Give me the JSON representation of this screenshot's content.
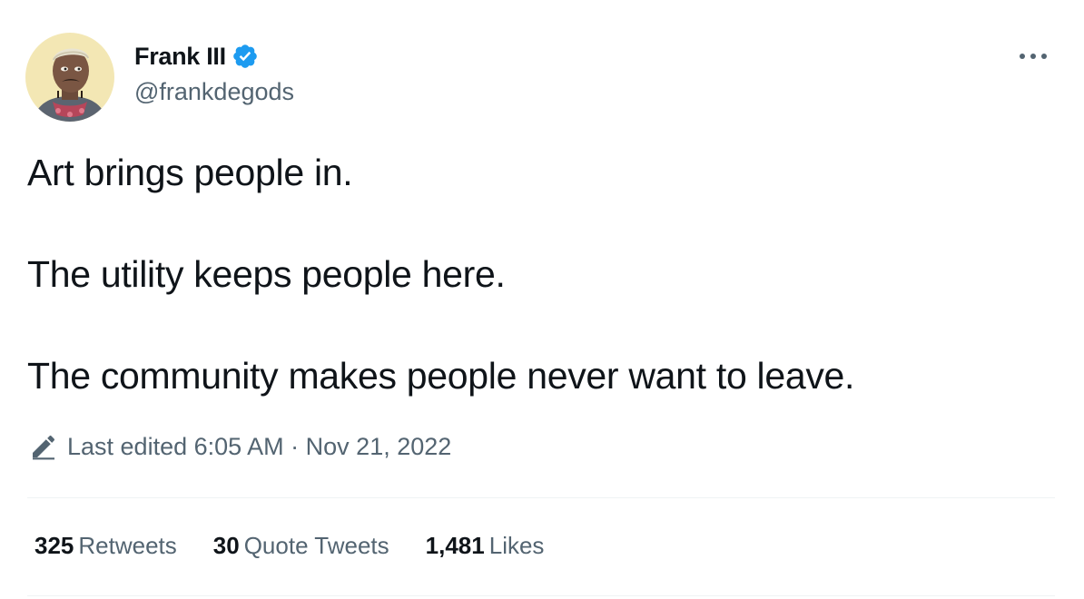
{
  "author": {
    "display_name": "Frank III",
    "handle": "@frankdegods",
    "verified": true,
    "verified_color": "#1d9bf0"
  },
  "more_icon": "more-horizontal-icon",
  "tweet": {
    "lines": [
      "Art brings people in.",
      "The utility keeps people here.",
      "The community makes people never want to leave."
    ]
  },
  "edited": {
    "icon": "pencil-icon",
    "text": "Last edited 6:05 AM · Nov 21, 2022"
  },
  "stats": {
    "retweets": {
      "count": "325",
      "label": "Retweets"
    },
    "quote_tweets": {
      "count": "30",
      "label": "Quote Tweets"
    },
    "likes": {
      "count": "1,481",
      "label": "Likes"
    }
  },
  "colors": {
    "text": "#0f1419",
    "secondary": "#536471",
    "divider": "#eff3f4",
    "avatar_bg": "#f3e7b4"
  }
}
